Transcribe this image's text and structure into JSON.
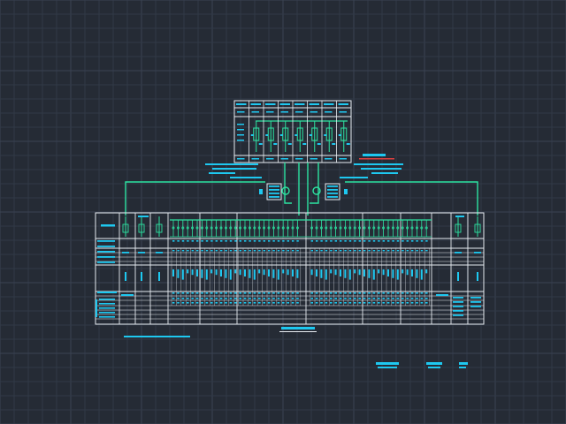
{
  "canvas": {
    "background": "#252b35",
    "grid_color": "#313946",
    "grid_major_color": "#3a4352"
  },
  "colors": {
    "outline": "#e8edf2",
    "text_block": "#1ec8f0",
    "bus_line": "#2de4a2",
    "accent_red": "#e04040",
    "accent_yellow": "#f0e040"
  },
  "drawing": {
    "upper_panel": {
      "columns": 8
    },
    "main_panel": {
      "left_columns": 2,
      "feeder_groups": 10,
      "right_columns": 2
    },
    "transformers": 2
  }
}
